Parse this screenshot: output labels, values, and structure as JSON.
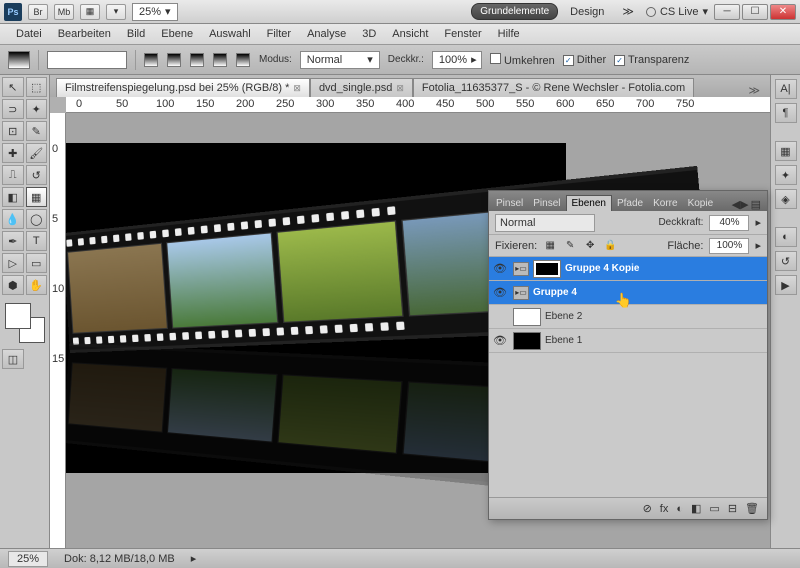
{
  "titlebar": {
    "logo": "Ps",
    "btns": [
      "Br",
      "Mb",
      "▦",
      "▾"
    ],
    "zoom": "25%",
    "workspace_active": "Grundelemente",
    "workspace_next": "Design",
    "more": "≫",
    "cslive": "CS Live",
    "win": {
      "min": "─",
      "max": "☐",
      "close": "✕"
    }
  },
  "menu": [
    "Datei",
    "Bearbeiten",
    "Bild",
    "Ebene",
    "Auswahl",
    "Filter",
    "Analyse",
    "3D",
    "Ansicht",
    "Fenster",
    "Hilfe"
  ],
  "options": {
    "modus_label": "Modus:",
    "modus_value": "Normal",
    "deck_label": "Deckkr.:",
    "deck_value": "100%",
    "umkehren": "Umkehren",
    "dither": "Dither",
    "transparenz": "Transparenz"
  },
  "tabs": [
    {
      "title": "Filmstreifenspiegelung.psd bei 25% (RGB/8) *",
      "active": true
    },
    {
      "title": "dvd_single.psd",
      "active": false
    },
    {
      "title": "Fotolia_11635377_S - © Rene Wechsler - Fotolia.com",
      "active": false
    }
  ],
  "ruler_marks": [
    "0",
    "50",
    "100",
    "150",
    "200",
    "250",
    "300",
    "350",
    "400",
    "450",
    "500",
    "550",
    "600",
    "650",
    "700",
    "750"
  ],
  "ruler_v": [
    "0",
    "5",
    "10",
    "15"
  ],
  "panel": {
    "tabs": [
      "Pinsel",
      "Pinsel",
      "Ebenen",
      "Pfade",
      "Korre",
      "Kopie"
    ],
    "active_tab": "Ebenen",
    "blend": "Normal",
    "deckkraft_label": "Deckkraft:",
    "deckkraft_value": "40%",
    "fixieren": "Fixieren:",
    "flaeche_label": "Fläche:",
    "flaeche_value": "100%",
    "layers": [
      {
        "name": "Gruppe 4 Kopie",
        "type": "group-mask",
        "sel": true,
        "vis": true
      },
      {
        "name": "Gruppe 4",
        "type": "group",
        "sel": true,
        "vis": true
      },
      {
        "name": "Ebene 2",
        "type": "white",
        "sel": false,
        "vis": false
      },
      {
        "name": "Ebene 1",
        "type": "black",
        "sel": false,
        "vis": true
      }
    ],
    "footer_icons": [
      "⊘",
      "fx",
      "◐",
      "◧",
      "▭",
      "⊟",
      "🗑"
    ]
  },
  "status": {
    "zoom": "25%",
    "dok": "Dok: 8,12 MB/18,0 MB"
  }
}
